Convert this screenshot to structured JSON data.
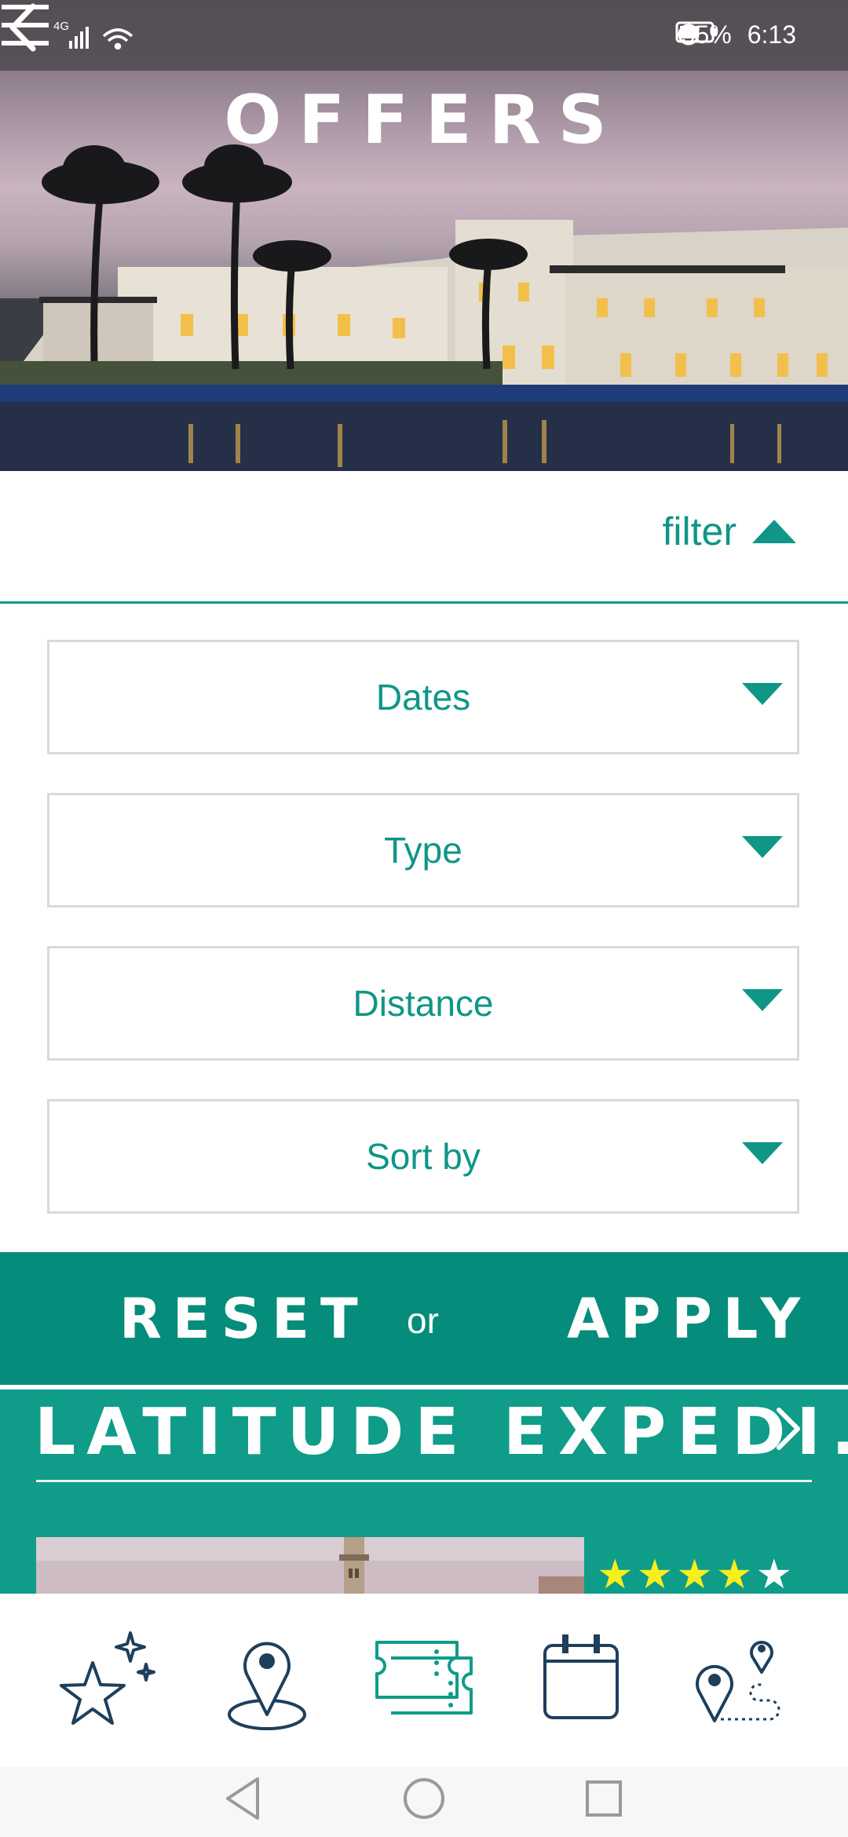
{
  "status_bar": {
    "network": "4G",
    "battery_percent": "55%",
    "time": "6:13",
    "icons": [
      "signal-icon",
      "wifi-icon",
      "alarm-icon",
      "battery-icon"
    ]
  },
  "header": {
    "title": "OFFERS",
    "back_icon": "chevron-left-icon",
    "menu_icon": "hamburger-menu-icon"
  },
  "filter": {
    "toggle_label": "filter",
    "toggle_icon": "triangle-up-icon",
    "dropdowns": [
      {
        "label": "Dates"
      },
      {
        "label": "Type"
      },
      {
        "label": "Distance"
      },
      {
        "label": "Sort by"
      }
    ]
  },
  "actions": {
    "reset_label": "RESET",
    "or_label": "or",
    "apply_label": "APPLY"
  },
  "offer": {
    "title": "LATITUDE EXPEDI...",
    "rating": 4.5,
    "rating_max": 5
  },
  "bottom_nav": {
    "items": [
      "stars-icon",
      "map-pin-icon",
      "tickets-icon",
      "calendar-icon",
      "route-icon"
    ]
  },
  "system_nav": {
    "items": [
      "back-triangle-icon",
      "home-circle-icon",
      "recents-square-icon"
    ]
  },
  "colors": {
    "accent": "#0f9686",
    "action_bar": "#058c7b",
    "card_bg": "#0f9c89",
    "nav_icon": "#1e3f5c",
    "star_filled": "#f7ef1c"
  }
}
